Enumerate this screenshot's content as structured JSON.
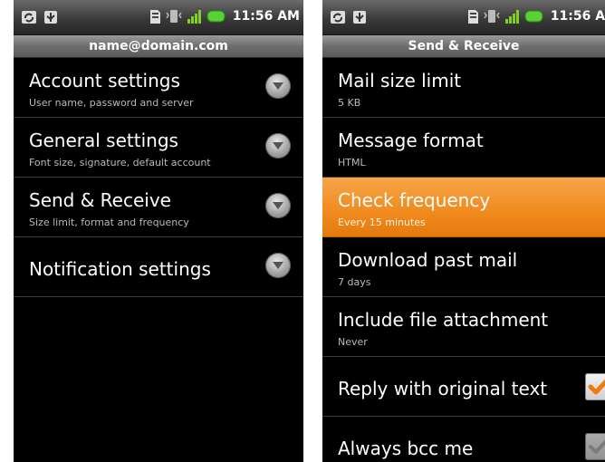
{
  "status_bar": {
    "time": "11:56 AM",
    "icons": [
      "sync-icon",
      "usb-icon",
      "sd-card-icon",
      "vibrate-icon",
      "signal-icon",
      "battery-icon"
    ]
  },
  "left_screen": {
    "title": "name@domain.com",
    "items": [
      {
        "title": "Account settings",
        "summary": "User name, password and server"
      },
      {
        "title": "General settings",
        "summary": "Font size, signature, default account"
      },
      {
        "title": "Send & Receive",
        "summary": "Size limit, format and frequency"
      },
      {
        "title": "Notification settings"
      }
    ]
  },
  "right_screen": {
    "title": "Send & Receive",
    "items": [
      {
        "title": "Mail size limit",
        "summary": "5 KB"
      },
      {
        "title": "Message format",
        "summary": "HTML"
      },
      {
        "title": "Check frequency",
        "summary": "Every 15 minutes",
        "selected": true
      },
      {
        "title": "Download past mail",
        "summary": "7 days"
      },
      {
        "title": "Include file attachment",
        "summary": "Never"
      },
      {
        "title": "Reply with original text",
        "checked": true
      },
      {
        "title": "Always bcc me",
        "checked": false
      }
    ]
  },
  "colors": {
    "highlight": "#f08a1c",
    "checkmark": "#f07a10"
  }
}
